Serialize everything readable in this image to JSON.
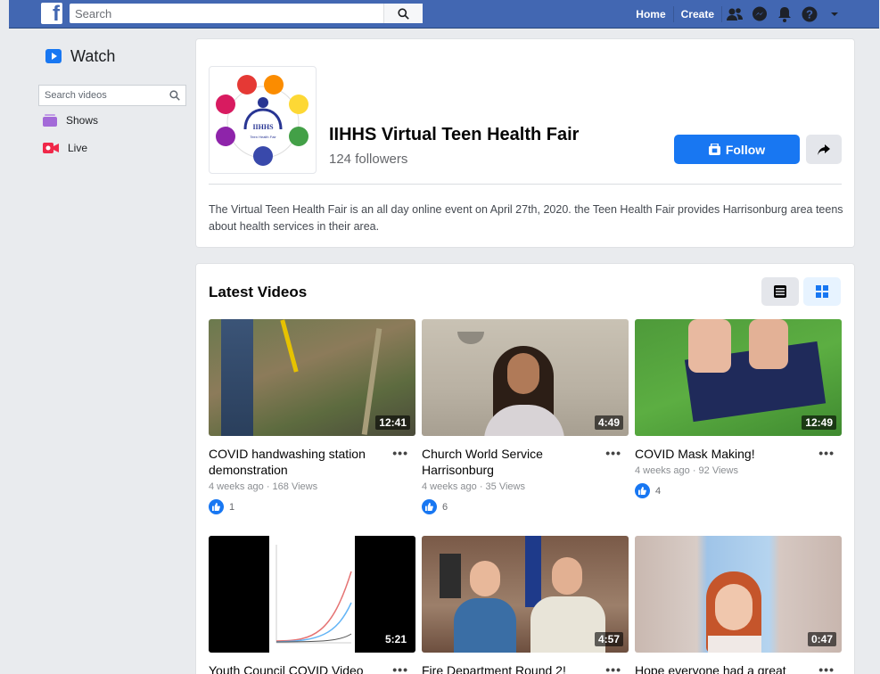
{
  "topbar": {
    "logo_letter": "f",
    "search_placeholder": "Search",
    "links": [
      "Home",
      "Create"
    ],
    "icons": [
      "friends-icon",
      "messenger-icon",
      "notifications-icon",
      "help-icon",
      "dropdown-icon"
    ]
  },
  "leftnav": {
    "title": "Watch",
    "search_placeholder": "Search videos",
    "items": [
      {
        "label": "Shows",
        "icon": "shows-icon"
      },
      {
        "label": "Live",
        "icon": "live-icon"
      }
    ]
  },
  "page": {
    "name": "IIHHS Virtual Teen Health Fair",
    "followers": "124 followers",
    "follow_label": "Follow",
    "logo_text": "IIHHS",
    "logo_subtext": "Teen Health Fair",
    "about": "The Virtual Teen Health Fair is an all day online event on April 27th, 2020. the Teen Health Fair provides Harrisonburg area teens about health services in their area."
  },
  "videos_section": {
    "title": "Latest Videos",
    "videos": [
      {
        "title": "COVID handwashing station demonstration",
        "duration": "12:41",
        "meta": "4 weeks ago · 168 Views",
        "likes": "1"
      },
      {
        "title": "Church World Service Harrisonburg",
        "duration": "4:49",
        "meta": "4 weeks ago · 35 Views",
        "likes": "6"
      },
      {
        "title": "COVID Mask Making!",
        "duration": "12:49",
        "meta": "4 weeks ago · 92 Views",
        "likes": "4"
      },
      {
        "title": "Youth Council COVID Video",
        "duration": "5:21"
      },
      {
        "title": "Fire Department Round 2!",
        "duration": "4:57"
      },
      {
        "title": "Hope everyone had a great",
        "duration": "0:47"
      }
    ]
  },
  "colors": {
    "brand": "#4267b2",
    "accent": "#1877f2",
    "background": "#e9ebee"
  }
}
